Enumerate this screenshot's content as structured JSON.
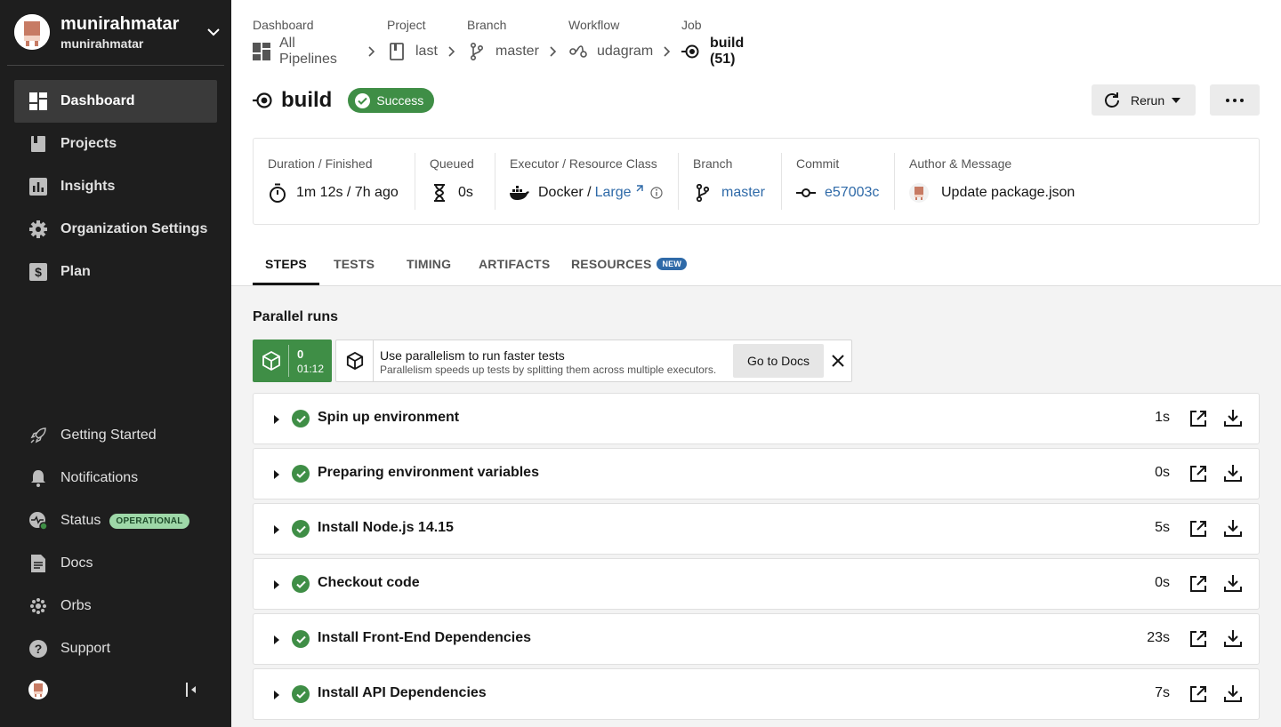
{
  "sidebar": {
    "org_name": "munirahmatar",
    "org_sub": "munirahmatar",
    "items": [
      {
        "label": "Dashboard",
        "icon": "dashboard-icon"
      },
      {
        "label": "Projects",
        "icon": "projects-icon"
      },
      {
        "label": "Insights",
        "icon": "insights-icon"
      },
      {
        "label": "Organization Settings",
        "icon": "gear-icon"
      },
      {
        "label": "Plan",
        "icon": "plan-icon"
      }
    ],
    "bottom_items": [
      {
        "label": "Getting Started",
        "icon": "rocket-icon"
      },
      {
        "label": "Notifications",
        "icon": "bell-icon"
      },
      {
        "label": "Status",
        "icon": "status-icon",
        "badge": "OPERATIONAL"
      },
      {
        "label": "Docs",
        "icon": "docs-icon"
      },
      {
        "label": "Orbs",
        "icon": "orbs-icon"
      },
      {
        "label": "Support",
        "icon": "help-icon"
      }
    ]
  },
  "breadcrumb": {
    "dashboard_label": "Dashboard",
    "dashboard_value": "All Pipelines",
    "project_label": "Project",
    "project_value": "last",
    "branch_label": "Branch",
    "branch_value": "master",
    "workflow_label": "Workflow",
    "workflow_value": "udagram",
    "job_label": "Job",
    "job_value": "build (51)"
  },
  "job": {
    "title": "build",
    "status": "Success",
    "rerun_label": "Rerun",
    "status_color": "#3f8e46"
  },
  "info": {
    "duration_label": "Duration / Finished",
    "duration_value": "1m 12s / 7h ago",
    "queued_label": "Queued",
    "queued_value": "0s",
    "executor_label": "Executor / Resource Class",
    "executor_value": "Docker /",
    "resource_class": "Large",
    "branch_label": "Branch",
    "branch_value": "master",
    "commit_label": "Commit",
    "commit_value": "e57003c",
    "author_label": "Author & Message",
    "author_message": "Update package.json"
  },
  "tabs": [
    {
      "label": "STEPS",
      "active": true
    },
    {
      "label": "TESTS"
    },
    {
      "label": "TIMING"
    },
    {
      "label": "ARTIFACTS"
    },
    {
      "label": "RESOURCES",
      "badge": "NEW"
    }
  ],
  "parallel": {
    "title": "Parallel runs",
    "run_index": "0",
    "run_time": "01:12",
    "tip_title": "Use parallelism to run faster tests",
    "tip_sub": "Parallelism speeds up tests by splitting them across multiple executors.",
    "docs_label": "Go to Docs"
  },
  "steps": [
    {
      "name": "Spin up environment",
      "duration": "1s"
    },
    {
      "name": "Preparing environment variables",
      "duration": "0s"
    },
    {
      "name": "Install Node.js 14.15",
      "duration": "5s"
    },
    {
      "name": "Checkout code",
      "duration": "0s"
    },
    {
      "name": "Install Front-End Dependencies",
      "duration": "23s"
    },
    {
      "name": "Install API Dependencies",
      "duration": "7s"
    }
  ]
}
